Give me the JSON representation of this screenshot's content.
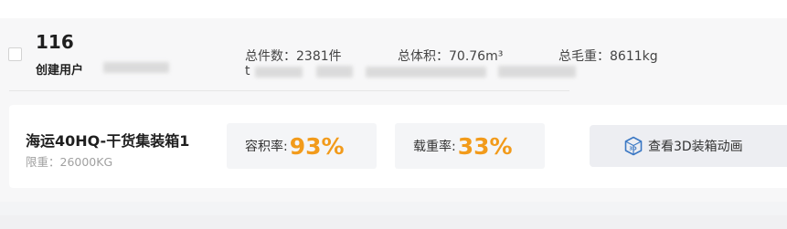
{
  "order": {
    "number": "116",
    "creator_label": "创建用户",
    "creator_value_redacted": true
  },
  "summary": {
    "total_count": "总件数：2381件",
    "total_volume": "总体积：70.76m³",
    "total_weight": "总毛重：8611kg",
    "second_line_prefix": "t"
  },
  "container": {
    "name": "海运40HQ-干货集装箱1",
    "limit": "限重：26000KG",
    "volume_rate_label": "容积率:",
    "volume_rate_value": "93%",
    "weight_rate_label": "载重率:",
    "weight_rate_value": "33%",
    "view_3d_button": "查看3D装箱动画"
  },
  "colors": {
    "accent_percent": "#f29b1b",
    "icon_blue": "#3b78c4"
  },
  "icons": {
    "view_3d": "3d-box-icon"
  }
}
